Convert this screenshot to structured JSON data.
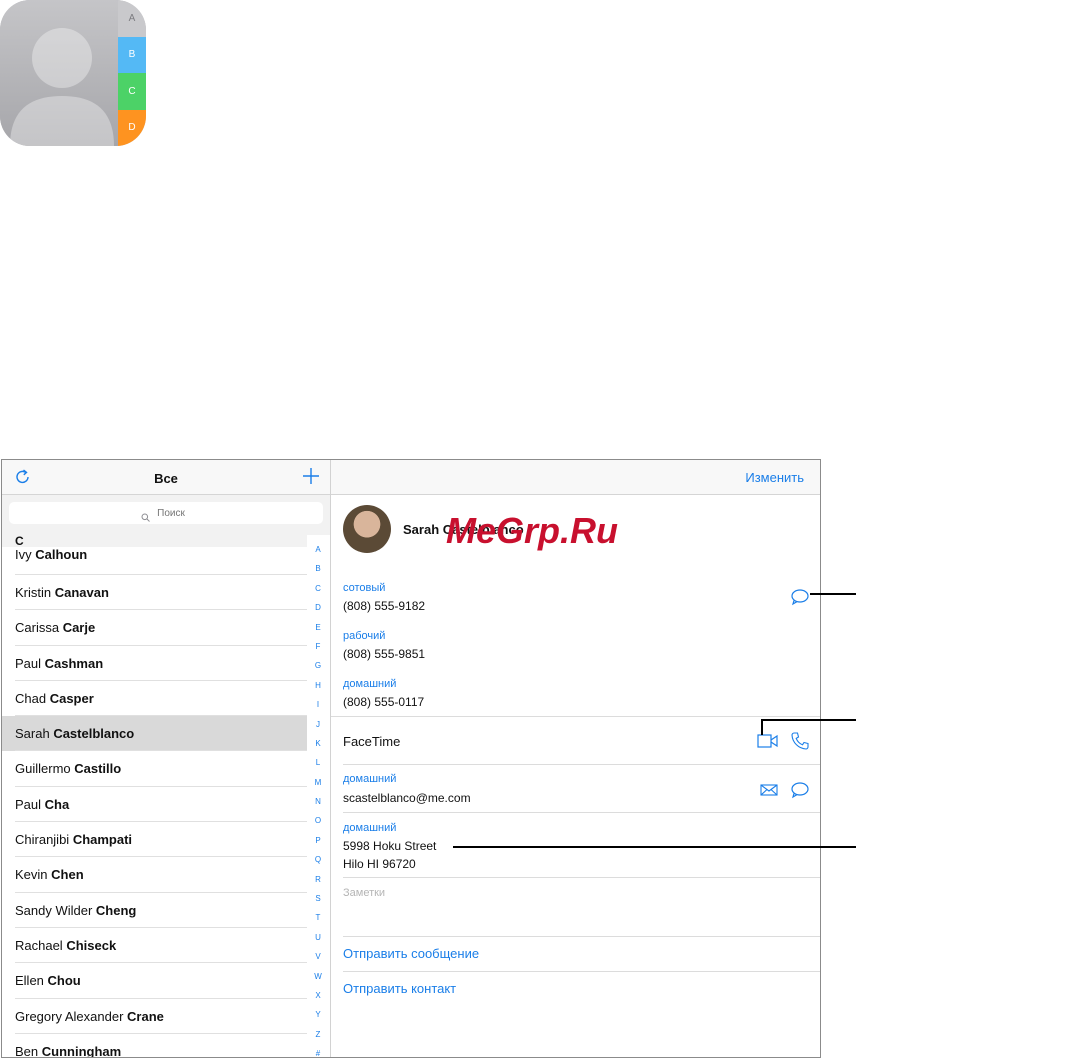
{
  "app_icon": {
    "tabs": [
      "A",
      "B",
      "C",
      "D"
    ]
  },
  "nav": {
    "title": "Все",
    "edit_label": "Изменить"
  },
  "search": {
    "placeholder": "Поиск"
  },
  "list": {
    "section_header": "C",
    "contacts": [
      {
        "first": "Ivy ",
        "last": "Calhoun"
      },
      {
        "first": "Kristin ",
        "last": "Canavan"
      },
      {
        "first": "Carissa ",
        "last": "Carje"
      },
      {
        "first": "Paul ",
        "last": "Cashman"
      },
      {
        "first": "Chad ",
        "last": "Casper"
      },
      {
        "first": "Sarah ",
        "last": "Castelblanco"
      },
      {
        "first": "Guillermo ",
        "last": "Castillo"
      },
      {
        "first": "Paul ",
        "last": "Cha"
      },
      {
        "first": "Chiranjibi ",
        "last": "Champati"
      },
      {
        "first": "Kevin ",
        "last": "Chen"
      },
      {
        "first": "Sandy Wilder ",
        "last": "Cheng"
      },
      {
        "first": "Rachael ",
        "last": "Chiseck"
      },
      {
        "first": "Ellen ",
        "last": "Chou"
      },
      {
        "first": "Gregory Alexander ",
        "last": "Crane"
      },
      {
        "first": "Ben ",
        "last": "Cunningham"
      }
    ],
    "selected_index": 5
  },
  "index_letters": [
    "A",
    "B",
    "C",
    "D",
    "E",
    "F",
    "G",
    "H",
    "I",
    "J",
    "K",
    "L",
    "M",
    "N",
    "O",
    "P",
    "Q",
    "R",
    "S",
    "T",
    "U",
    "V",
    "W",
    "X",
    "Y",
    "Z",
    "#"
  ],
  "detail": {
    "name": "Sarah Castelblanco",
    "phones": [
      {
        "label": "сотовый",
        "value": "(808) 555-9182"
      },
      {
        "label": "рабочий",
        "value": "(808) 555-9851"
      },
      {
        "label": "домашний",
        "value": "(808) 555-0117"
      }
    ],
    "facetime_label": "FaceTime",
    "email": {
      "label": "домашний",
      "value": "scastelblanco@me.com"
    },
    "address": {
      "label": "домашний",
      "line1": "5998 Hoku Street",
      "line2": "Hilo HI 96720"
    },
    "notes_label": "Заметки",
    "send_message": "Отправить сообщение",
    "share_contact": "Отправить контакт"
  },
  "watermark": "MeGrp.Ru",
  "colors": {
    "accent": "#1a7ee8",
    "selected_row": "#d9d9d9"
  }
}
